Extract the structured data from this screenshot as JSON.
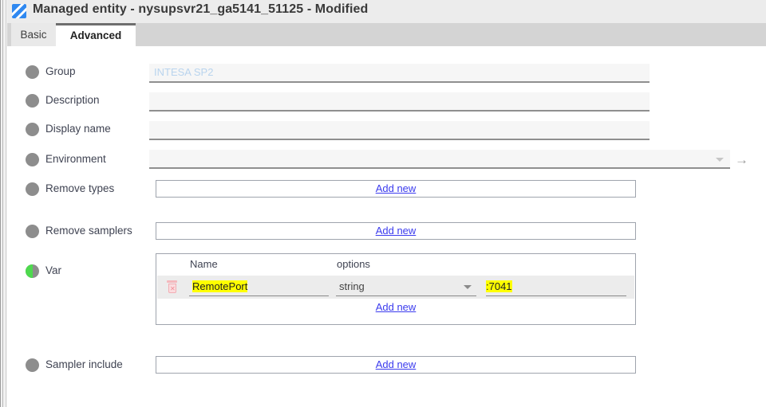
{
  "window": {
    "icon": "edit-document-icon",
    "title": "Managed entity - nysupsvr21_ga5141_51125 - Modified"
  },
  "tabs": [
    {
      "label": "Basic",
      "active": false
    },
    {
      "label": "Advanced",
      "active": true
    }
  ],
  "colors": {
    "titlebar_bg": "#ececec",
    "tabstrip_bg": "#d4d4d4",
    "bullet_gray": "#8d8d8d",
    "bullet_green": "#4ed94e",
    "link_blue": "#3b3bee",
    "highlight_yellow": "#ffff00",
    "placeholder_blue": "#b9d4ee",
    "trash_pink": "#f4b8bd"
  },
  "form": {
    "rows": [
      {
        "label": "Group",
        "bullet": "gray",
        "control": "text",
        "value": "",
        "placeholder": "INTESA SP2"
      },
      {
        "label": "Description",
        "bullet": "gray",
        "control": "text",
        "value": "",
        "placeholder": ""
      },
      {
        "label": "Display name",
        "bullet": "gray",
        "control": "text",
        "value": "",
        "placeholder": ""
      },
      {
        "label": "Environment",
        "bullet": "gray",
        "control": "combo",
        "value": "",
        "placeholder": ""
      },
      {
        "label": "Remove types",
        "bullet": "gray",
        "control": "addbox",
        "add_label": "Add new"
      },
      {
        "label": "Remove samplers",
        "bullet": "gray",
        "control": "addbox",
        "add_label": "Add new"
      },
      {
        "label": "Var",
        "bullet": "green",
        "control": "table"
      },
      {
        "label": "Sampler include",
        "bullet": "gray",
        "control": "addbox",
        "add_label": "Add new"
      }
    ]
  },
  "var_table": {
    "headers": [
      "Name",
      "options"
    ],
    "rows": [
      {
        "name": "RemotePort",
        "name_highlighted": true,
        "type": "string",
        "value": ":7041",
        "value_highlighted": true,
        "delete_icon": "trash-icon"
      }
    ],
    "add_label": "Add new"
  },
  "icons": {
    "dropdown_caret": "chevron-down-icon",
    "go_arrow": "arrow-right-icon"
  }
}
